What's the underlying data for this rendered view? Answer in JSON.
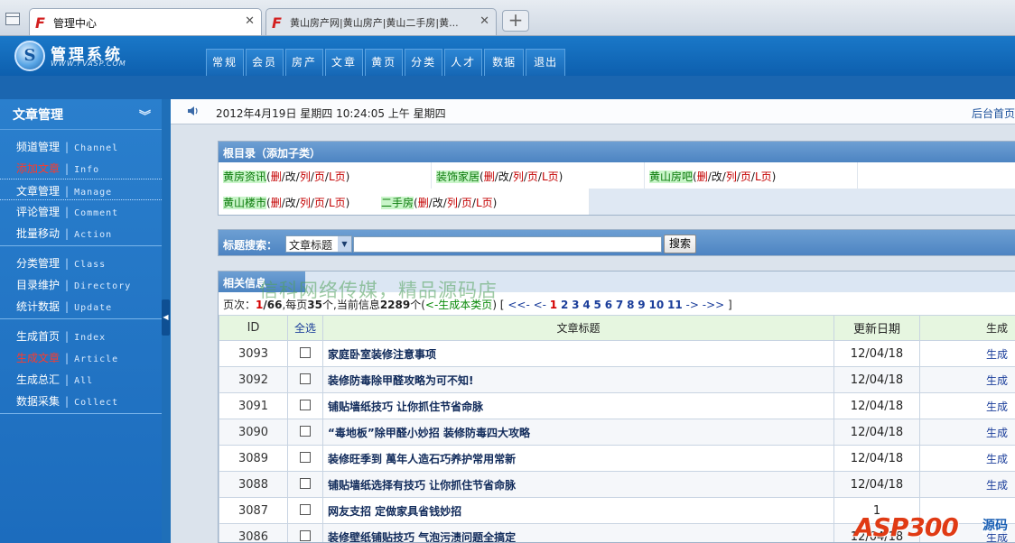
{
  "browser": {
    "tabs": [
      {
        "label": "管理中心",
        "active": true
      },
      {
        "label": "黄山房产网|黄山房产|黄山二手房|黄...",
        "active": false
      }
    ],
    "close_glyph": "✕",
    "new_tab_glyph": "+"
  },
  "header": {
    "logo_mark": "S",
    "title": "管理系统",
    "subtitle": "WWW.FVASP.COM",
    "nav": [
      "常规",
      "会员",
      "房产",
      "文章",
      "黄页",
      "分类",
      "人才",
      "数据",
      "退出"
    ]
  },
  "sidebar": {
    "title": "文章管理",
    "groups": [
      [
        {
          "cn": "频道管理",
          "en": "Channel"
        },
        {
          "cn": "添加文章",
          "en": "Info",
          "red": true
        },
        {
          "cn": "文章管理",
          "en": "Manage",
          "selected": true
        },
        {
          "cn": "评论管理",
          "en": "Comment"
        },
        {
          "cn": "批量移动",
          "en": "Action"
        }
      ],
      [
        {
          "cn": "分类管理",
          "en": "Class"
        },
        {
          "cn": "目录维护",
          "en": "Directory"
        },
        {
          "cn": "统计数据",
          "en": "Update"
        }
      ],
      [
        {
          "cn": "生成首页",
          "en": "Index"
        },
        {
          "cn": "生成文章",
          "en": "Article",
          "red": true
        },
        {
          "cn": "生成总汇",
          "en": "All"
        },
        {
          "cn": "数据采集",
          "en": "Collect"
        }
      ]
    ]
  },
  "infobar": {
    "datetime": "2012年4月19日 星期四 10:24:05 上午 星期四",
    "home_link": "后台首页"
  },
  "root_dir": {
    "title": "根目录（添加子类）",
    "actions": [
      "删",
      "改",
      "列",
      "页",
      "L页"
    ],
    "categories": [
      "黄房资讯",
      "装饰家居",
      "黄山房吧",
      "黄山楼市",
      "二手房"
    ]
  },
  "search": {
    "label": "标题搜索：",
    "select_value": "文章标题",
    "input_value": "",
    "button": "搜索"
  },
  "list": {
    "title": "相关信息",
    "watermark": "信科网络传媒，精品源码店",
    "pager": {
      "prefix": "页次：",
      "current": "1",
      "total": "/66",
      "per_page_text": ",每页",
      "per_page": "35",
      "count_text": "个,当前信息",
      "count": "2289",
      "count_suffix": "个(",
      "gen_link": "<-生成本类页",
      "gen_suffix": ") [",
      "nav_prev": "<<- <-",
      "pages": [
        "1",
        "2",
        "3",
        "4",
        "5",
        "6",
        "7",
        "8",
        "9",
        "10",
        "11"
      ],
      "nav_next": "-> ->>",
      "close": "]"
    },
    "columns": [
      "ID",
      "全选",
      "文章标题",
      "更新日期",
      "生成"
    ],
    "rows": [
      {
        "id": "3093",
        "title": "家庭卧室装修注意事项",
        "date": "12/04/18",
        "gen": "生成"
      },
      {
        "id": "3092",
        "title": "装修防毒除甲醛攻略为可不知!",
        "date": "12/04/18",
        "gen": "生成"
      },
      {
        "id": "3091",
        "title": "铺贴墙纸技巧 让你抓住节省命脉",
        "date": "12/04/18",
        "gen": "生成"
      },
      {
        "id": "3090",
        "title": "“毒地板”除甲醛小妙招 装修防毒四大攻略",
        "date": "12/04/18",
        "gen": "生成"
      },
      {
        "id": "3089",
        "title": "装修旺季到 萬年人造石巧养护常用常新",
        "date": "12/04/18",
        "gen": "生成"
      },
      {
        "id": "3088",
        "title": "铺贴墙纸选择有技巧 让你抓住节省命脉",
        "date": "12/04/18",
        "gen": "生成"
      },
      {
        "id": "3087",
        "title": "网友支招 定做家具省钱妙招",
        "date": "1",
        "gen": ""
      },
      {
        "id": "3086",
        "title": "装修壁纸铺贴技巧 气泡污渍问题全搞定",
        "date": "12/04/18",
        "gen": "生成"
      }
    ]
  },
  "corner_logo": {
    "brand": "ASP300",
    "code": "源码"
  }
}
